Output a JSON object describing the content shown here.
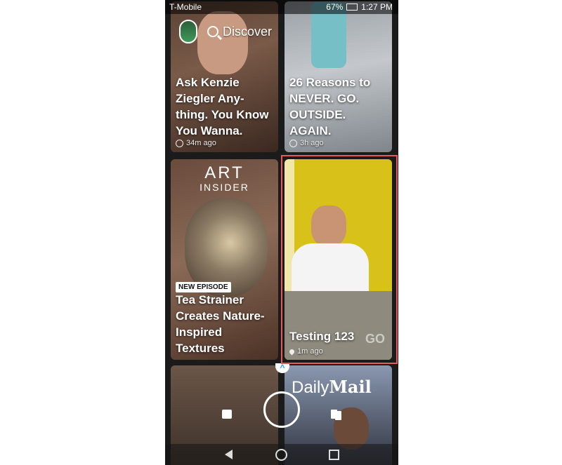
{
  "status_bar": {
    "carrier": "T-Mobile",
    "battery": "67%",
    "time": "1:27 PM"
  },
  "header": {
    "title": "Discover"
  },
  "tiles": [
    {
      "caption": "Ask Kenzie Ziegler Any-thing. You Know You Wanna.",
      "time": "34m ago"
    },
    {
      "caption": "26 Reasons to NEVER. GO. OUTSIDE. AGAIN.",
      "time": "3h ago"
    },
    {
      "logo_line1": "ART",
      "logo_line2": "INSIDER",
      "badge": "NEW EPISODE",
      "caption": "Tea Strainer Creates Nature-Inspired Textures"
    },
    {
      "caption": "Testing 123",
      "watermark": "GO",
      "time": "1m ago"
    },
    {
      "caption": ""
    },
    {
      "logo_daily": "Daily",
      "logo_mail": "Mail"
    }
  ],
  "icons": {
    "search": "search-icon",
    "globe": "globe-icon",
    "pin": "location-pin-icon",
    "chat": "chat-icon",
    "stories": "stories-icon",
    "capture": "capture-button",
    "back": "back-icon",
    "home": "home-icon",
    "recents": "recents-icon"
  },
  "colors": {
    "highlight": "#e55a5a",
    "chevron": "#1aa2e8",
    "tile4_bg": "#d8c21a"
  }
}
